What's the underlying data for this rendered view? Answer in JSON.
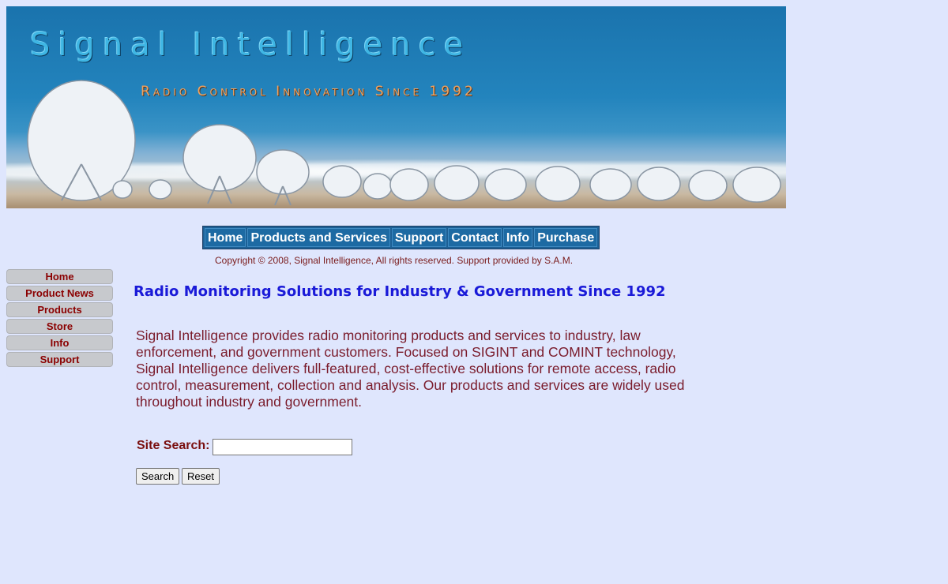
{
  "banner": {
    "title": "Signal Intelligence",
    "subtitle": "Radio Control Innovation Since 1992"
  },
  "topnav": [
    "Home",
    "Products and Services",
    "Support",
    "Contact",
    "Info",
    "Purchase"
  ],
  "copyright": "Copyright © 2008, Signal Intelligence,  All rights reserved.  Support provided by S.A.M.",
  "sidenav": [
    "Home",
    "Product News",
    "Products",
    "Store",
    "Info",
    "Support"
  ],
  "headline": "Radio Monitoring Solutions for Industry & Government Since 1992",
  "intro": "Signal Intelligence provides radio monitoring products and services to industry, law enforcement, and government customers. Focused on SIGINT and COMINT technology, Signal Intelligence delivers full-featured, cost-effective solutions for remote access, radio control, measurement, collection and analysis. Our products and services are widely used throughout industry and government.",
  "search": {
    "label": "Site Search:",
    "value": "",
    "search_button": "Search",
    "reset_button": "Reset"
  }
}
